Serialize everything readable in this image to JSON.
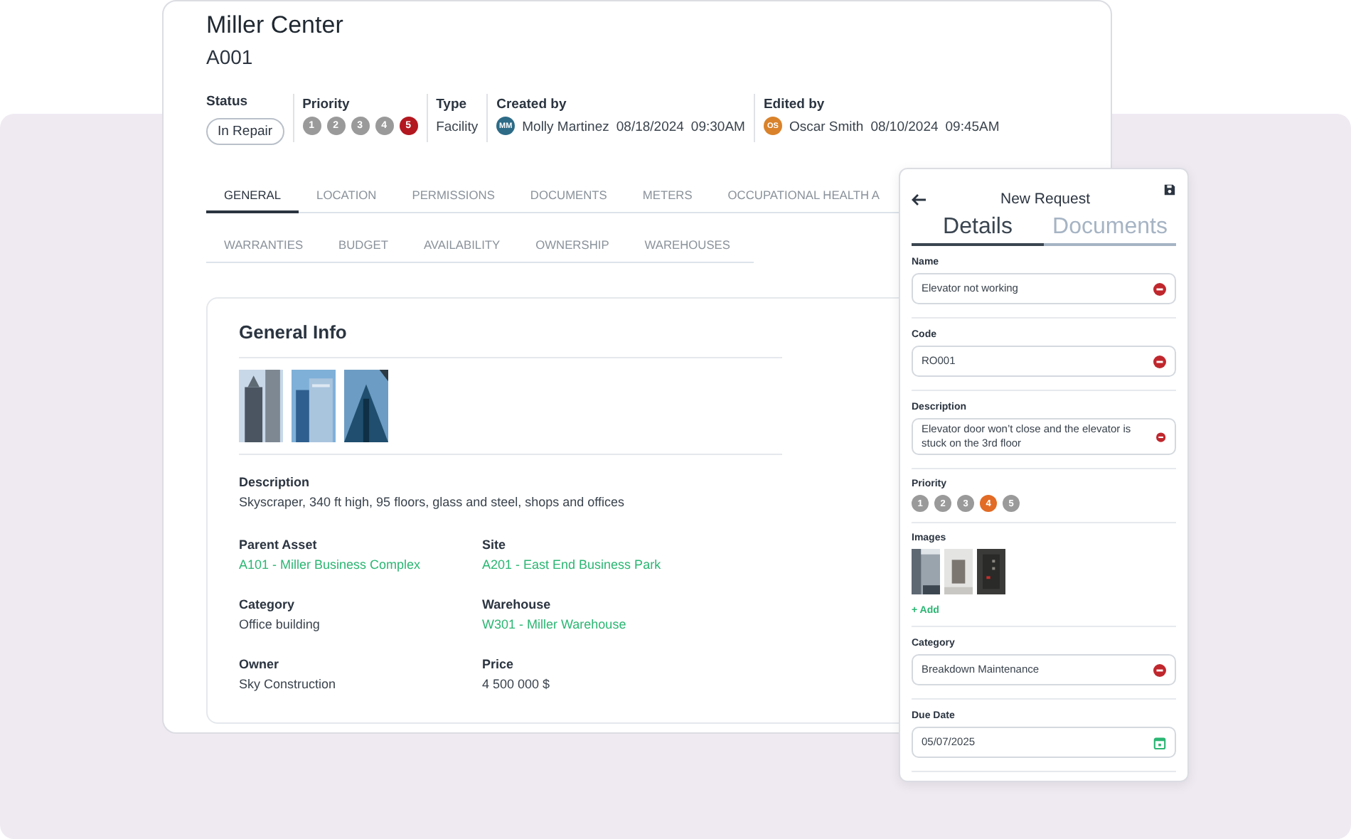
{
  "asset": {
    "title": "Miller Center",
    "code": "A001"
  },
  "meta": {
    "status": {
      "label": "Status",
      "value": "In Repair"
    },
    "priority": {
      "label": "Priority",
      "levels": [
        {
          "label": "1",
          "selected": false
        },
        {
          "label": "2",
          "selected": false
        },
        {
          "label": "3",
          "selected": false
        },
        {
          "label": "4",
          "selected": false
        },
        {
          "label": "5",
          "selected": true
        }
      ]
    },
    "type": {
      "label": "Type",
      "value": "Facility"
    },
    "created": {
      "label": "Created by",
      "initials": "MM",
      "color": "#2d6b87",
      "name": "Molly Martinez",
      "date": "08/18/2024",
      "time": "09:30AM"
    },
    "edited": {
      "label": "Edited by",
      "initials": "OS",
      "color": "#d9822b",
      "name": "Oscar Smith",
      "date": "08/10/2024",
      "time": "09:45AM"
    }
  },
  "tabs": [
    {
      "label": "GENERAL",
      "selected": true
    },
    {
      "label": "LOCATION",
      "selected": false
    },
    {
      "label": "PERMISSIONS",
      "selected": false
    },
    {
      "label": "DOCUMENTS",
      "selected": false
    },
    {
      "label": "METERS",
      "selected": false
    },
    {
      "label": "OCCUPATIONAL HEALTH A",
      "selected": false
    }
  ],
  "subtabs": [
    {
      "label": "WARRANTIES",
      "selected": false
    },
    {
      "label": "BUDGET",
      "selected": false
    },
    {
      "label": "AVAILABILITY",
      "selected": false
    },
    {
      "label": "OWNERSHIP",
      "selected": false
    },
    {
      "label": "WAREHOUSES",
      "selected": false
    }
  ],
  "general_info": {
    "title": "General Info",
    "description": {
      "label": "Description",
      "value": "Skyscraper, 340 ft high, 95 floors, glass and steel, shops and offices"
    },
    "fields": [
      {
        "label": "Parent Asset",
        "value": "A101 - Miller Business Complex",
        "kind": "link"
      },
      {
        "label": "Site",
        "value": "A201 - East End Business Park",
        "kind": "link"
      },
      {
        "label": "Category",
        "value": "Office building",
        "kind": "text"
      },
      {
        "label": "Warehouse",
        "value": "W301 - Miller Warehouse",
        "kind": "link"
      },
      {
        "label": "Owner",
        "value": "Sky Construction",
        "kind": "text"
      },
      {
        "label": "Price",
        "value": "4 500 000 $",
        "kind": "text"
      }
    ]
  },
  "request": {
    "title": "New Request",
    "tabs": [
      {
        "label": "Details",
        "selected": true
      },
      {
        "label": "Documents",
        "selected": false
      }
    ],
    "sections": [
      {
        "kind": "text",
        "label": "Name",
        "value": "Elevator not working"
      },
      {
        "kind": "text",
        "label": "Code",
        "value": "RO001"
      },
      {
        "kind": "text",
        "label": "Description",
        "value": "Elevator door won’t close and the elevator is stuck on the 3rd floor"
      },
      {
        "kind": "priority",
        "label": "Priority",
        "levels": [
          {
            "label": "1",
            "selected": false
          },
          {
            "label": "2",
            "selected": false
          },
          {
            "label": "3",
            "selected": false
          },
          {
            "label": "4",
            "selected": true
          },
          {
            "label": "5",
            "selected": false
          }
        ]
      },
      {
        "kind": "images",
        "label": "Images",
        "add": "+ Add"
      },
      {
        "kind": "text",
        "label": "Category",
        "value": "Breakdown Maintenance"
      },
      {
        "kind": "date",
        "label": "Due Date",
        "value": "05/07/2025"
      }
    ]
  }
}
